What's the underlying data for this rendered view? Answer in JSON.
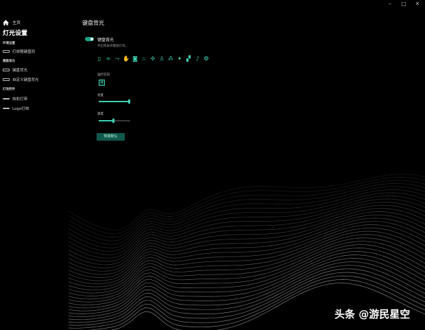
{
  "window": {
    "minimize": "–",
    "maximize": "□",
    "close": "✕"
  },
  "sidebar": {
    "home_label": "主页",
    "page_title": "灯光设置",
    "sections": [
      {
        "label": "环境设置",
        "items": [
          {
            "label": "灯效随键盘同"
          }
        ]
      },
      {
        "label": "键盘背光",
        "items": [
          {
            "label": "键盘背光"
          },
          {
            "label": "自定义键盘背光"
          }
        ]
      },
      {
        "label": "灯效控件",
        "items": [
          {
            "label": "炫彩灯带"
          },
          {
            "label": "Logo灯效"
          }
        ]
      }
    ]
  },
  "main": {
    "title": "键盘背光",
    "toggle": {
      "label": "键盘背光",
      "description": "开启或关闭键盘灯效。",
      "on": true
    },
    "effects": [
      "rect-icon",
      "wave-icon",
      "ripple-icon",
      "hand-icon",
      "circle-icon",
      "drop-icon",
      "fan-icon",
      "person-icon",
      "rain-icon",
      "sparkle-icon",
      "stairs-icon",
      "music-note-icon",
      "fire-icon"
    ],
    "direction_label": "运行方向",
    "brightness_label": "亮度",
    "brightness_value": 1.0,
    "speed_label": "速度",
    "speed_value": 0.5,
    "custom_button": "恢复默认"
  },
  "watermark": "头条 @游民星空",
  "colors": {
    "accent": "#3fd0b3",
    "button": "#0f5a4c",
    "background": "#000000"
  }
}
